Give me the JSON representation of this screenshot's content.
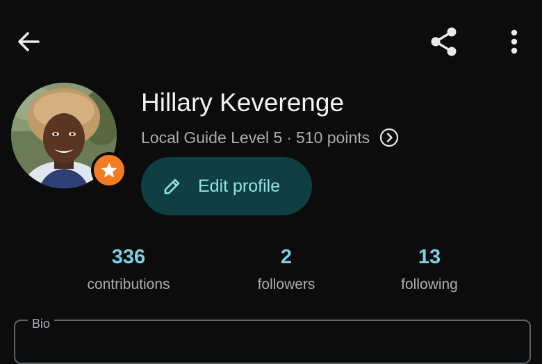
{
  "toolbar": {
    "back_icon": "arrow-left-icon",
    "share_icon": "share-icon",
    "more_icon": "more-vertical-icon"
  },
  "profile": {
    "name": "Hillary Keverenge",
    "level_text": "Local Guide Level 5",
    "separator": "·",
    "points_text": "510 points",
    "badge_icon": "star-icon",
    "badge_color": "#f37b22",
    "edit_label": "Edit profile",
    "edit_icon": "pencil-icon"
  },
  "stats": [
    {
      "value": "336",
      "label": "contributions"
    },
    {
      "value": "2",
      "label": "followers"
    },
    {
      "value": "13",
      "label": "following"
    }
  ],
  "bio": {
    "label": "Bio"
  },
  "colors": {
    "background": "#0c0c0c",
    "accent": "#7ecfe0",
    "button_bg": "#0f3f42",
    "button_text": "#8fe3ea"
  }
}
